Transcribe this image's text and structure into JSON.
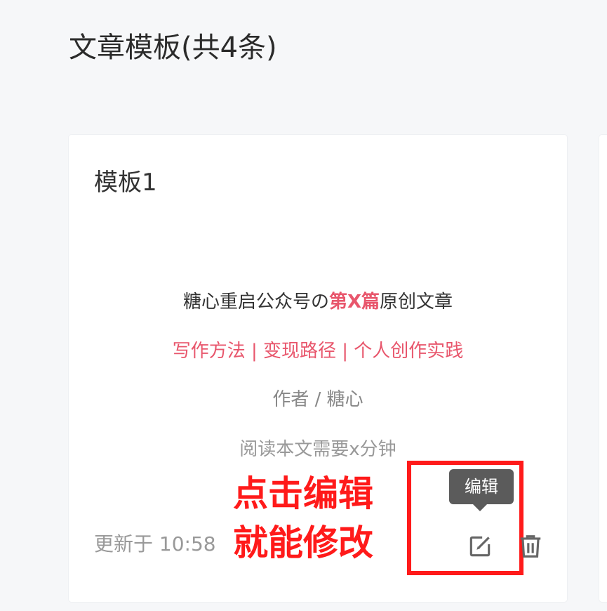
{
  "header": {
    "title": "文章模板(共4条)"
  },
  "card": {
    "title": "模板1",
    "preview": {
      "line1_prefix": "糖心重启公众号の",
      "line1_accent": "第X篇",
      "line1_suffix": "原创文章",
      "line2": "写作方法 | 变现路径 | 个人创作实践",
      "line3": "作者 / 糖心",
      "line4": "阅读本文需要x分钟"
    },
    "updated_text": "更新于 10:58",
    "edit_icon": "edit-icon",
    "delete_icon": "trash-icon",
    "tooltip": "编辑"
  },
  "annotation": {
    "line1": "点击编辑",
    "line2": "就能修改",
    "color": "#ff1a1a"
  },
  "colors": {
    "accent": "#e8566c",
    "background": "#f6f7f9"
  }
}
